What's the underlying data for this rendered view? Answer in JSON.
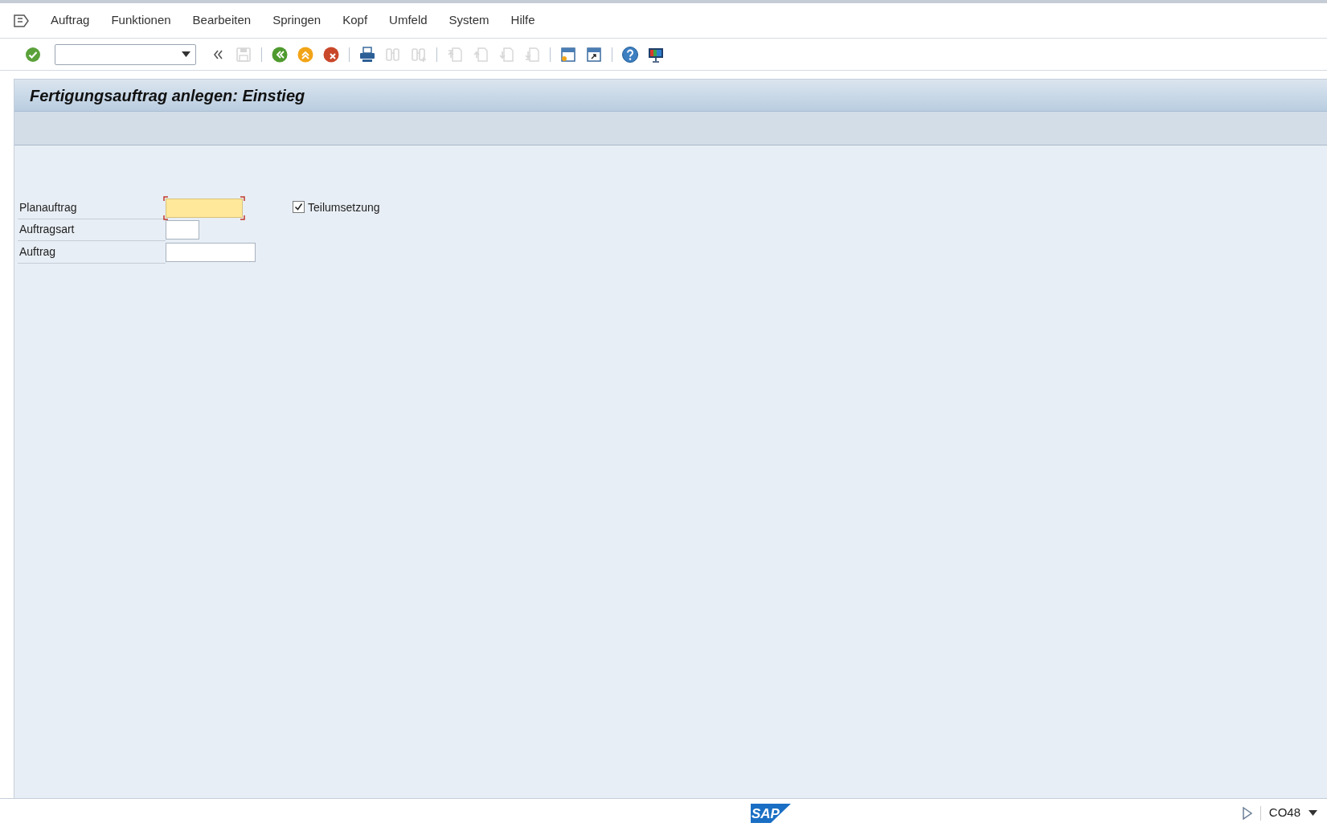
{
  "menu": [
    {
      "label": "Auftrag"
    },
    {
      "label": "Funktionen"
    },
    {
      "label": "Bearbeiten"
    },
    {
      "label": "Springen"
    },
    {
      "label": "Kopf"
    },
    {
      "label": "Umfeld"
    },
    {
      "label": "System"
    },
    {
      "label": "Hilfe"
    }
  ],
  "toolbar": [
    {
      "kind": "enter",
      "disabled": false
    },
    {
      "kind": "command",
      "disabled": false
    },
    {
      "kind": "collapse",
      "disabled": false
    },
    {
      "kind": "save",
      "disabled": true
    },
    {
      "kind": "sep"
    },
    {
      "kind": "back",
      "disabled": false
    },
    {
      "kind": "exit",
      "disabled": false
    },
    {
      "kind": "cancel",
      "disabled": false
    },
    {
      "kind": "sep"
    },
    {
      "kind": "print",
      "disabled": false
    },
    {
      "kind": "find",
      "disabled": true
    },
    {
      "kind": "findnext",
      "disabled": true
    },
    {
      "kind": "sep"
    },
    {
      "kind": "first",
      "disabled": true
    },
    {
      "kind": "prev",
      "disabled": true
    },
    {
      "kind": "next",
      "disabled": true
    },
    {
      "kind": "last",
      "disabled": true
    },
    {
      "kind": "sep"
    },
    {
      "kind": "newsession",
      "disabled": false
    },
    {
      "kind": "shortcut",
      "disabled": false
    },
    {
      "kind": "sep"
    },
    {
      "kind": "help",
      "disabled": false
    },
    {
      "kind": "layout",
      "disabled": false
    }
  ],
  "title": "Fertigungsauftrag anlegen: Einstieg",
  "fields": [
    {
      "label": "Planauftrag",
      "focused": true
    },
    {
      "label": "Auftragsart",
      "focused": false
    },
    {
      "label": "Auftrag",
      "focused": false
    }
  ],
  "checkbox": {
    "label": "Teilumsetzung",
    "checked": true
  },
  "status_bar": {
    "logo_text": "SAP",
    "transaction": "CO48"
  }
}
